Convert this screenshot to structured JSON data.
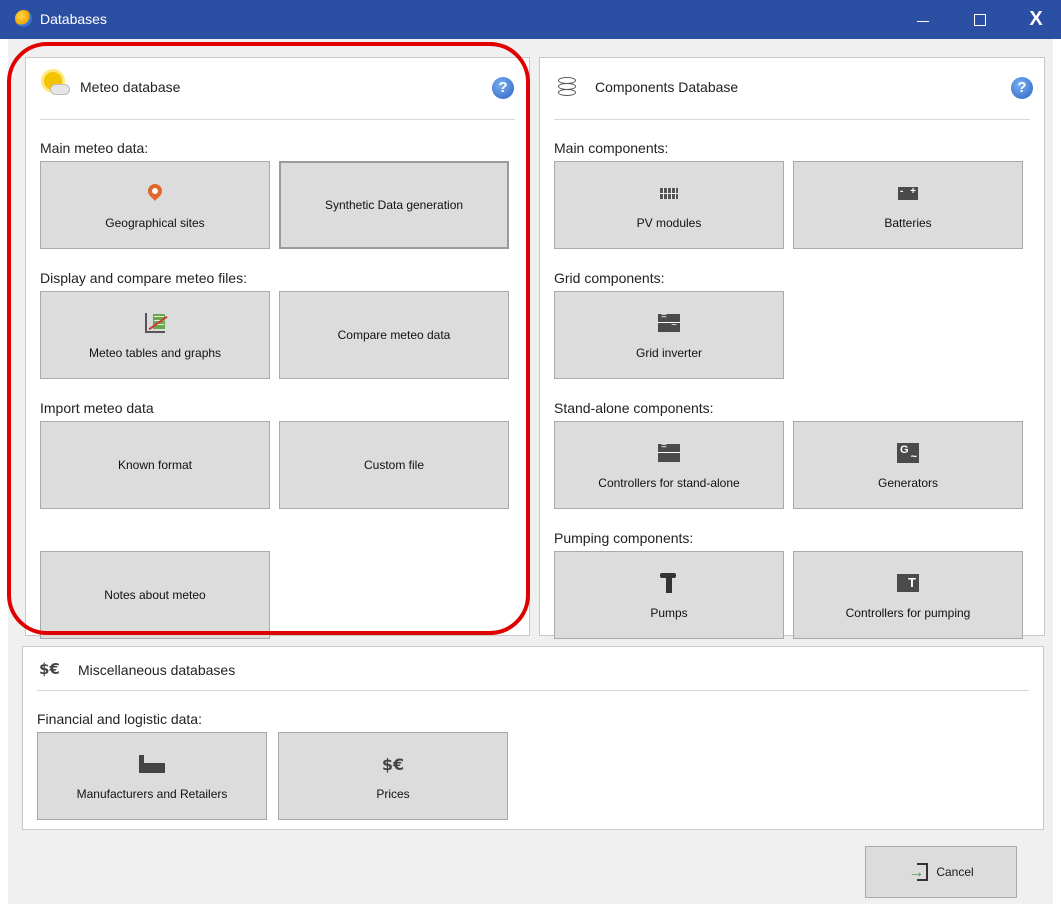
{
  "window": {
    "title": "Databases",
    "controls": {
      "minimize_icon": "minimize-icon",
      "maximize_icon": "maximize-icon",
      "close_label": "X"
    }
  },
  "meteo": {
    "title": "Meteo database",
    "help": "?",
    "main_label": "Main meteo data:",
    "geo_sites": "Geographical sites",
    "synthetic": "Synthetic Data generation",
    "display_label": "Display and compare meteo files:",
    "tables_graphs": "Meteo tables and graphs",
    "compare": "Compare meteo data",
    "import_label": "Import meteo data",
    "known_format": "Known format",
    "custom_file": "Custom file",
    "notes": "Notes about meteo"
  },
  "components": {
    "title": "Components Database",
    "help": "?",
    "main_label": "Main components:",
    "pv_modules": "PV modules",
    "batteries": "Batteries",
    "grid_label": "Grid components:",
    "grid_inverter": "Grid inverter",
    "standalone_label": "Stand-alone components:",
    "controllers_standalone": "Controllers for stand-alone",
    "generators": "Generators",
    "pumping_label": "Pumping components:",
    "pumps": "Pumps",
    "controllers_pumping": "Controllers for pumping"
  },
  "misc": {
    "title": "Miscellaneous databases",
    "financial_label": "Financial and logistic data:",
    "manufacturers": "Manufacturers and Retailers",
    "prices": "Prices",
    "money_glyph": "$€"
  },
  "footer": {
    "cancel": "Cancel"
  },
  "colors": {
    "titlebar": "#2b4fa3",
    "highlight": "#e00000",
    "tile": "#dcdcdc"
  }
}
